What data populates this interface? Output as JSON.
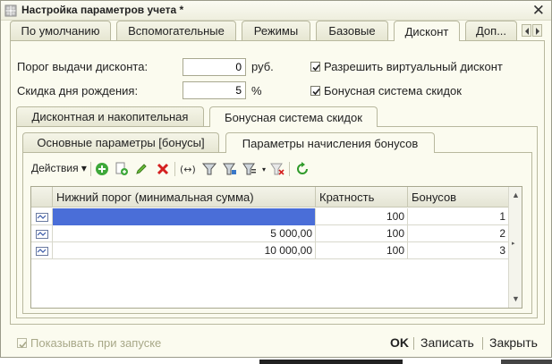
{
  "window": {
    "title": "Настройка параметров учета *"
  },
  "top_tabs": [
    {
      "label": "По умолчанию"
    },
    {
      "label": "Вспомогательные"
    },
    {
      "label": "Режимы"
    },
    {
      "label": "Базовые"
    },
    {
      "label": "Дисконт"
    },
    {
      "label": "Доп..."
    }
  ],
  "active_top_tab": "Дисконт",
  "discount": {
    "threshold_label": "Порог выдачи дисконта:",
    "threshold_value": "0",
    "threshold_unit": "руб.",
    "birthday_label": "Скидка дня рождения:",
    "birthday_value": "5",
    "birthday_unit": "%",
    "allow_virtual_label": "Разрешить виртуальный дисконт",
    "allow_virtual_checked": true,
    "bonus_system_label": "Бонусная система скидок",
    "bonus_system_checked": true
  },
  "sub_tabs": [
    {
      "label": "Дисконтная и накопительная"
    },
    {
      "label": "Бонусная система скидок"
    }
  ],
  "inner_tabs": [
    {
      "label": "Основные параметры [бонусы]"
    },
    {
      "label": "Параметры начисления бонусов"
    }
  ],
  "toolbar": {
    "actions_label": "Действия",
    "icons": [
      "add-icon",
      "copy-add-icon",
      "edit-icon",
      "delete-icon",
      "move-icon",
      "filter-icon",
      "filter-by-value-icon",
      "filter-list-icon",
      "clear-filter-icon",
      "refresh-icon"
    ]
  },
  "table": {
    "columns": [
      "Нижний порог (минимальная сумма)",
      "Кратность",
      "Бонусов"
    ],
    "rows": [
      {
        "threshold": "",
        "multiplicity": "100",
        "bonus": "1",
        "selected": true
      },
      {
        "threshold": "5 000,00",
        "multiplicity": "100",
        "bonus": "2",
        "selected": false
      },
      {
        "threshold": "10 000,00",
        "multiplicity": "100",
        "bonus": "3",
        "selected": false
      }
    ]
  },
  "footer": {
    "show_on_start_label": "Показывать при запуске",
    "show_on_start_checked": true,
    "ok_label": "OK",
    "save_label": "Записать",
    "close_label": "Закрыть"
  },
  "colors": {
    "window_bg": "#fbfbef",
    "selected_row": "#4a6ed8"
  }
}
